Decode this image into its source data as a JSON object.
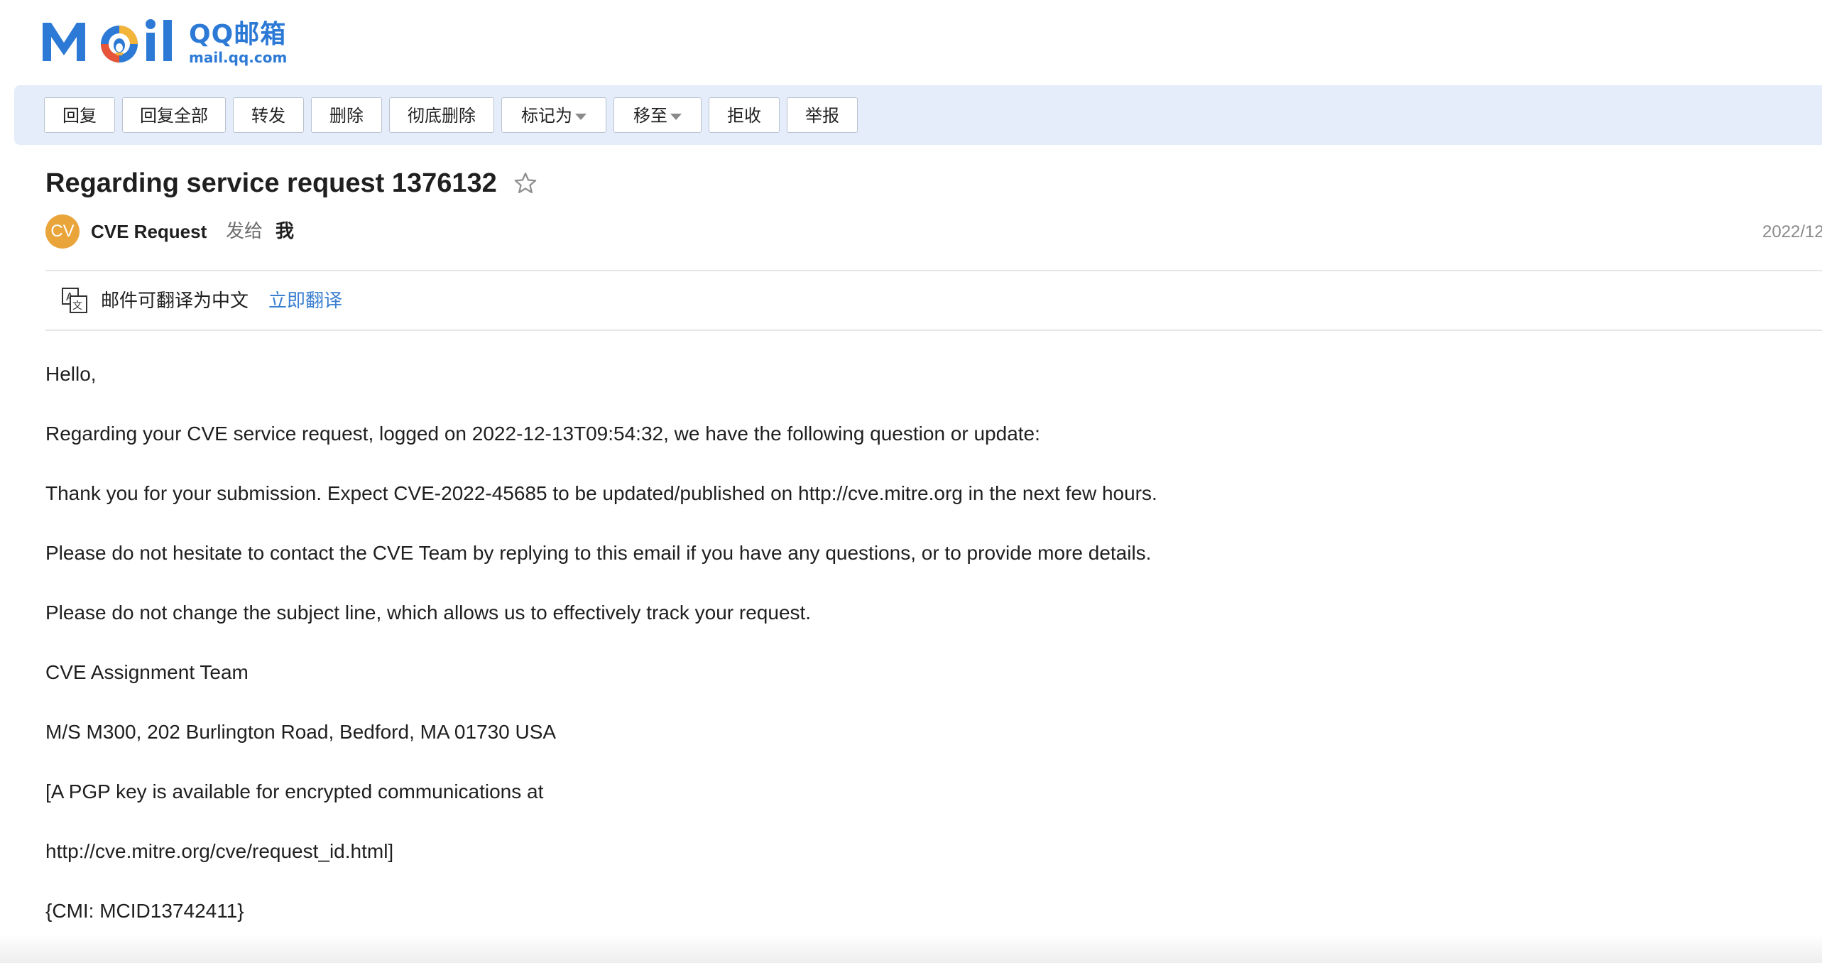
{
  "logo": {
    "cn": "QQ邮箱",
    "url": "mail.qq.com"
  },
  "toolbar": {
    "buttons": [
      {
        "label": "回复"
      },
      {
        "label": "回复全部"
      },
      {
        "label": "转发"
      },
      {
        "label": "删除"
      },
      {
        "label": "彻底删除"
      },
      {
        "label": "标记为"
      },
      {
        "label": "移至"
      },
      {
        "label": "拒收"
      },
      {
        "label": "举报"
      }
    ]
  },
  "email": {
    "subject": "Regarding service request 1376132",
    "sender_avatar": "CV",
    "sender": "CVE Request",
    "sendto_label": "发给",
    "recipient": "我",
    "date": "2022/12",
    "translate_text": "邮件可翻译为中文",
    "translate_link": "立即翻译",
    "body": [
      "Hello,",
      "Regarding your CVE service request, logged on 2022-12-13T09:54:32, we have the following question or update:",
      "Thank you for your submission. Expect CVE-2022-45685 to be updated/published on http://cve.mitre.org in the next few hours.",
      "Please do not hesitate to contact the CVE Team by replying to this email if you have any questions, or to provide more details.",
      "Please do not change the subject line, which allows us to effectively track your request.",
      "CVE Assignment Team",
      "M/S M300, 202 Burlington Road, Bedford, MA 01730 USA",
      "[A PGP key is available for encrypted communications at",
      "http://cve.mitre.org/cve/request_id.html]",
      "{CMI: MCID13742411}"
    ]
  },
  "icons": {
    "star": "star-outline-icon",
    "translate": "translate-icon",
    "caret": "caret-down-icon"
  },
  "colors": {
    "toolbar_bg": "#e4edf9",
    "brand_blue": "#2c7ad6",
    "link_blue": "#3a7fd1",
    "avatar_bg": "#e9a43a"
  }
}
